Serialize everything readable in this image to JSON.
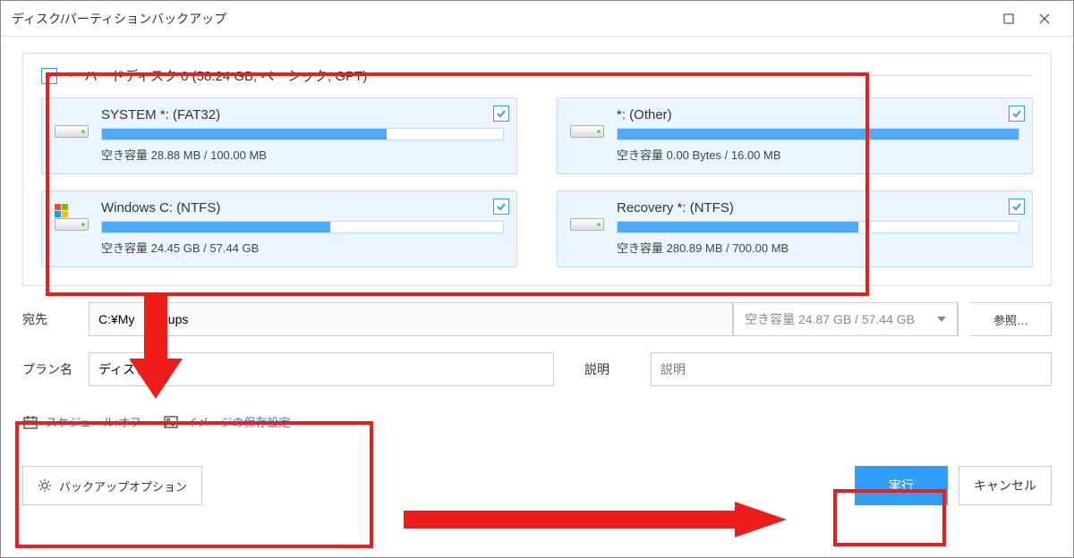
{
  "window": {
    "title": "ディスク/パーティションバックアップ"
  },
  "disk": {
    "title": "ハードディスク 0 (58.24 GB, ベーシック, GPT)",
    "partitions": [
      {
        "name": "SYSTEM *: (FAT32)",
        "free_label": "空き容量 28.88 MB / 100.00 MB",
        "used_pct": 71,
        "checked": true,
        "windows": false
      },
      {
        "name": "*: (Other)",
        "free_label": "空き容量 0.00 Bytes / 16.00 MB",
        "used_pct": 100,
        "checked": true,
        "windows": false
      },
      {
        "name": "Windows C: (NTFS)",
        "free_label": "空き容量 24.45 GB / 57.44 GB",
        "used_pct": 57,
        "checked": true,
        "windows": true
      },
      {
        "name": "Recovery *: (NTFS)",
        "free_label": "空き容量 280.89 MB / 700.00 MB",
        "used_pct": 60,
        "checked": true,
        "windows": false
      }
    ]
  },
  "destination": {
    "label": "宛先",
    "path": "C:¥My      ckups",
    "free_label": "空き容量 24.87 GB / 57.44 GB",
    "browse": "参照…"
  },
  "plan": {
    "label": "プラン名",
    "value": "ディスク",
    "desc_label": "説明",
    "desc_placeholder": "説明"
  },
  "options": {
    "schedule": "スケジュール:オフ",
    "retention": "イメージの保存設定",
    "backup_options": "バックアップオプション"
  },
  "buttons": {
    "execute": "実行",
    "cancel": "キャンセル"
  }
}
